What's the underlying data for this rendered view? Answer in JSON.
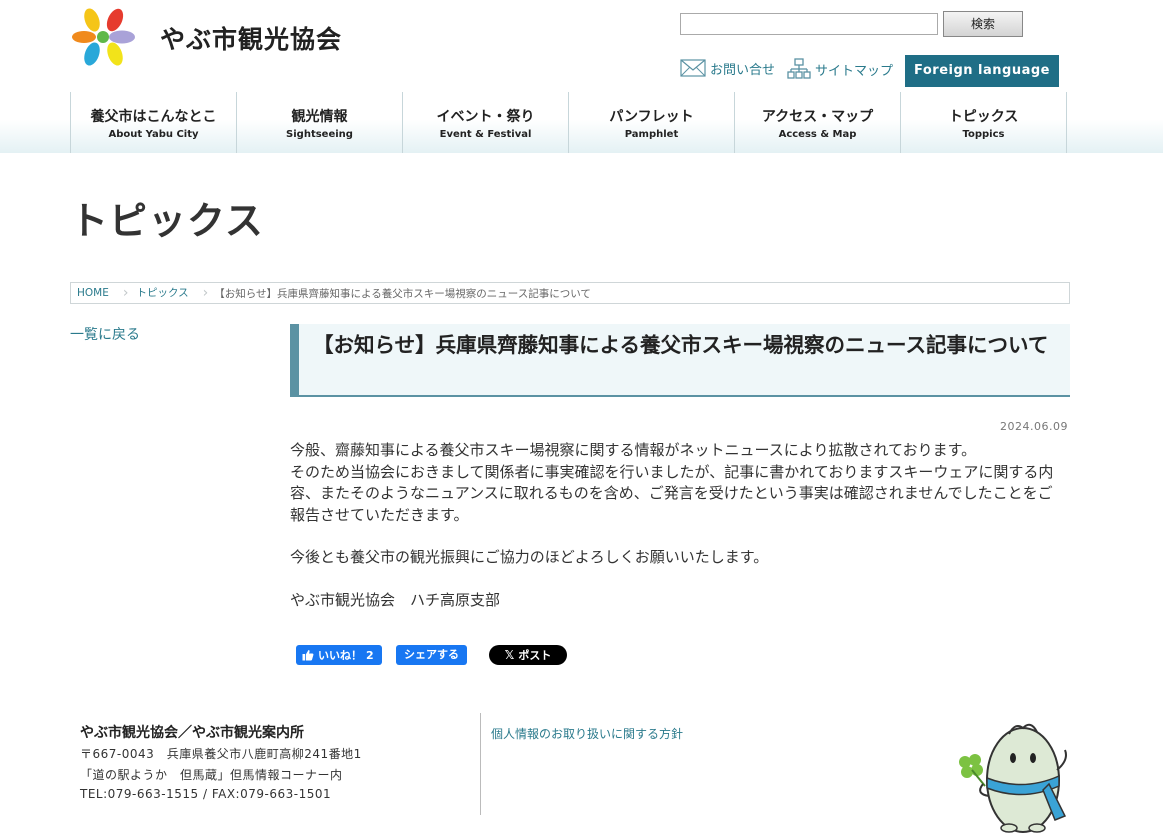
{
  "header": {
    "site_title": "やぶ市観光協会",
    "search_placeholder": "",
    "search_button": "検索",
    "contact_label": "お問い合せ",
    "sitemap_label": "サイトマップ",
    "foreign_button": "Foreign language"
  },
  "nav": [
    {
      "jp": "養父市はこんなとこ",
      "en": "About Yabu City"
    },
    {
      "jp": "観光情報",
      "en": "Sightseeing"
    },
    {
      "jp": "イベント・祭り",
      "en": "Event & Festival"
    },
    {
      "jp": "パンフレット",
      "en": "Pamphlet"
    },
    {
      "jp": "アクセス・マップ",
      "en": "Access & Map"
    },
    {
      "jp": "トピックス",
      "en": "Toppics"
    }
  ],
  "page_title": "トピックス",
  "breadcrumb": {
    "home": "HOME",
    "section": "トピックス",
    "current": "【お知らせ】兵庫県齊藤知事による養父市スキー場視察のニュース記事について"
  },
  "side": {
    "back_link": "一覧に戻る"
  },
  "article": {
    "title": "【お知らせ】兵庫県齊藤知事による養父市スキー場視察のニュース記事について",
    "date": "2024.06.09",
    "para1": "今般、齋藤知事による養父市スキー場視察に関する情報がネットニュースにより拡散されております。",
    "para2": "そのため当協会におきまして関係者に事実確認を行いましたが、記事に書かれておりますスキーウェアに関する内容、またそのようなニュアンスに取れるものを含め、ご発言を受けたという事実は確認されませんでしたことをご報告させていただきます。",
    "para3": "今後とも養父市の観光振興にご協力のほどよろしくお願いいたします。",
    "signature": "やぶ市観光協会　ハチ高原支部"
  },
  "social": {
    "like_label": "いいね！",
    "like_count": "2",
    "share_label": "シェアする",
    "post_label": "ポスト"
  },
  "footer": {
    "org": "やぶ市観光協会／やぶ市観光案内所",
    "address": "〒667-0043　兵庫県養父市八鹿町高柳241番地1",
    "location": "「道の駅ようか　但馬蔵」但馬情報コーナー内",
    "phone": "TEL:079-663-1515 / FAX:079-663-1501",
    "privacy_link": "個人情報のお取り扱いに関する方針"
  },
  "colors": {
    "accent": "#1f6e86",
    "link": "#2a7a8c",
    "title_border": "#5b92a3",
    "title_bg": "#eff7f9",
    "facebook": "#1877f2"
  }
}
